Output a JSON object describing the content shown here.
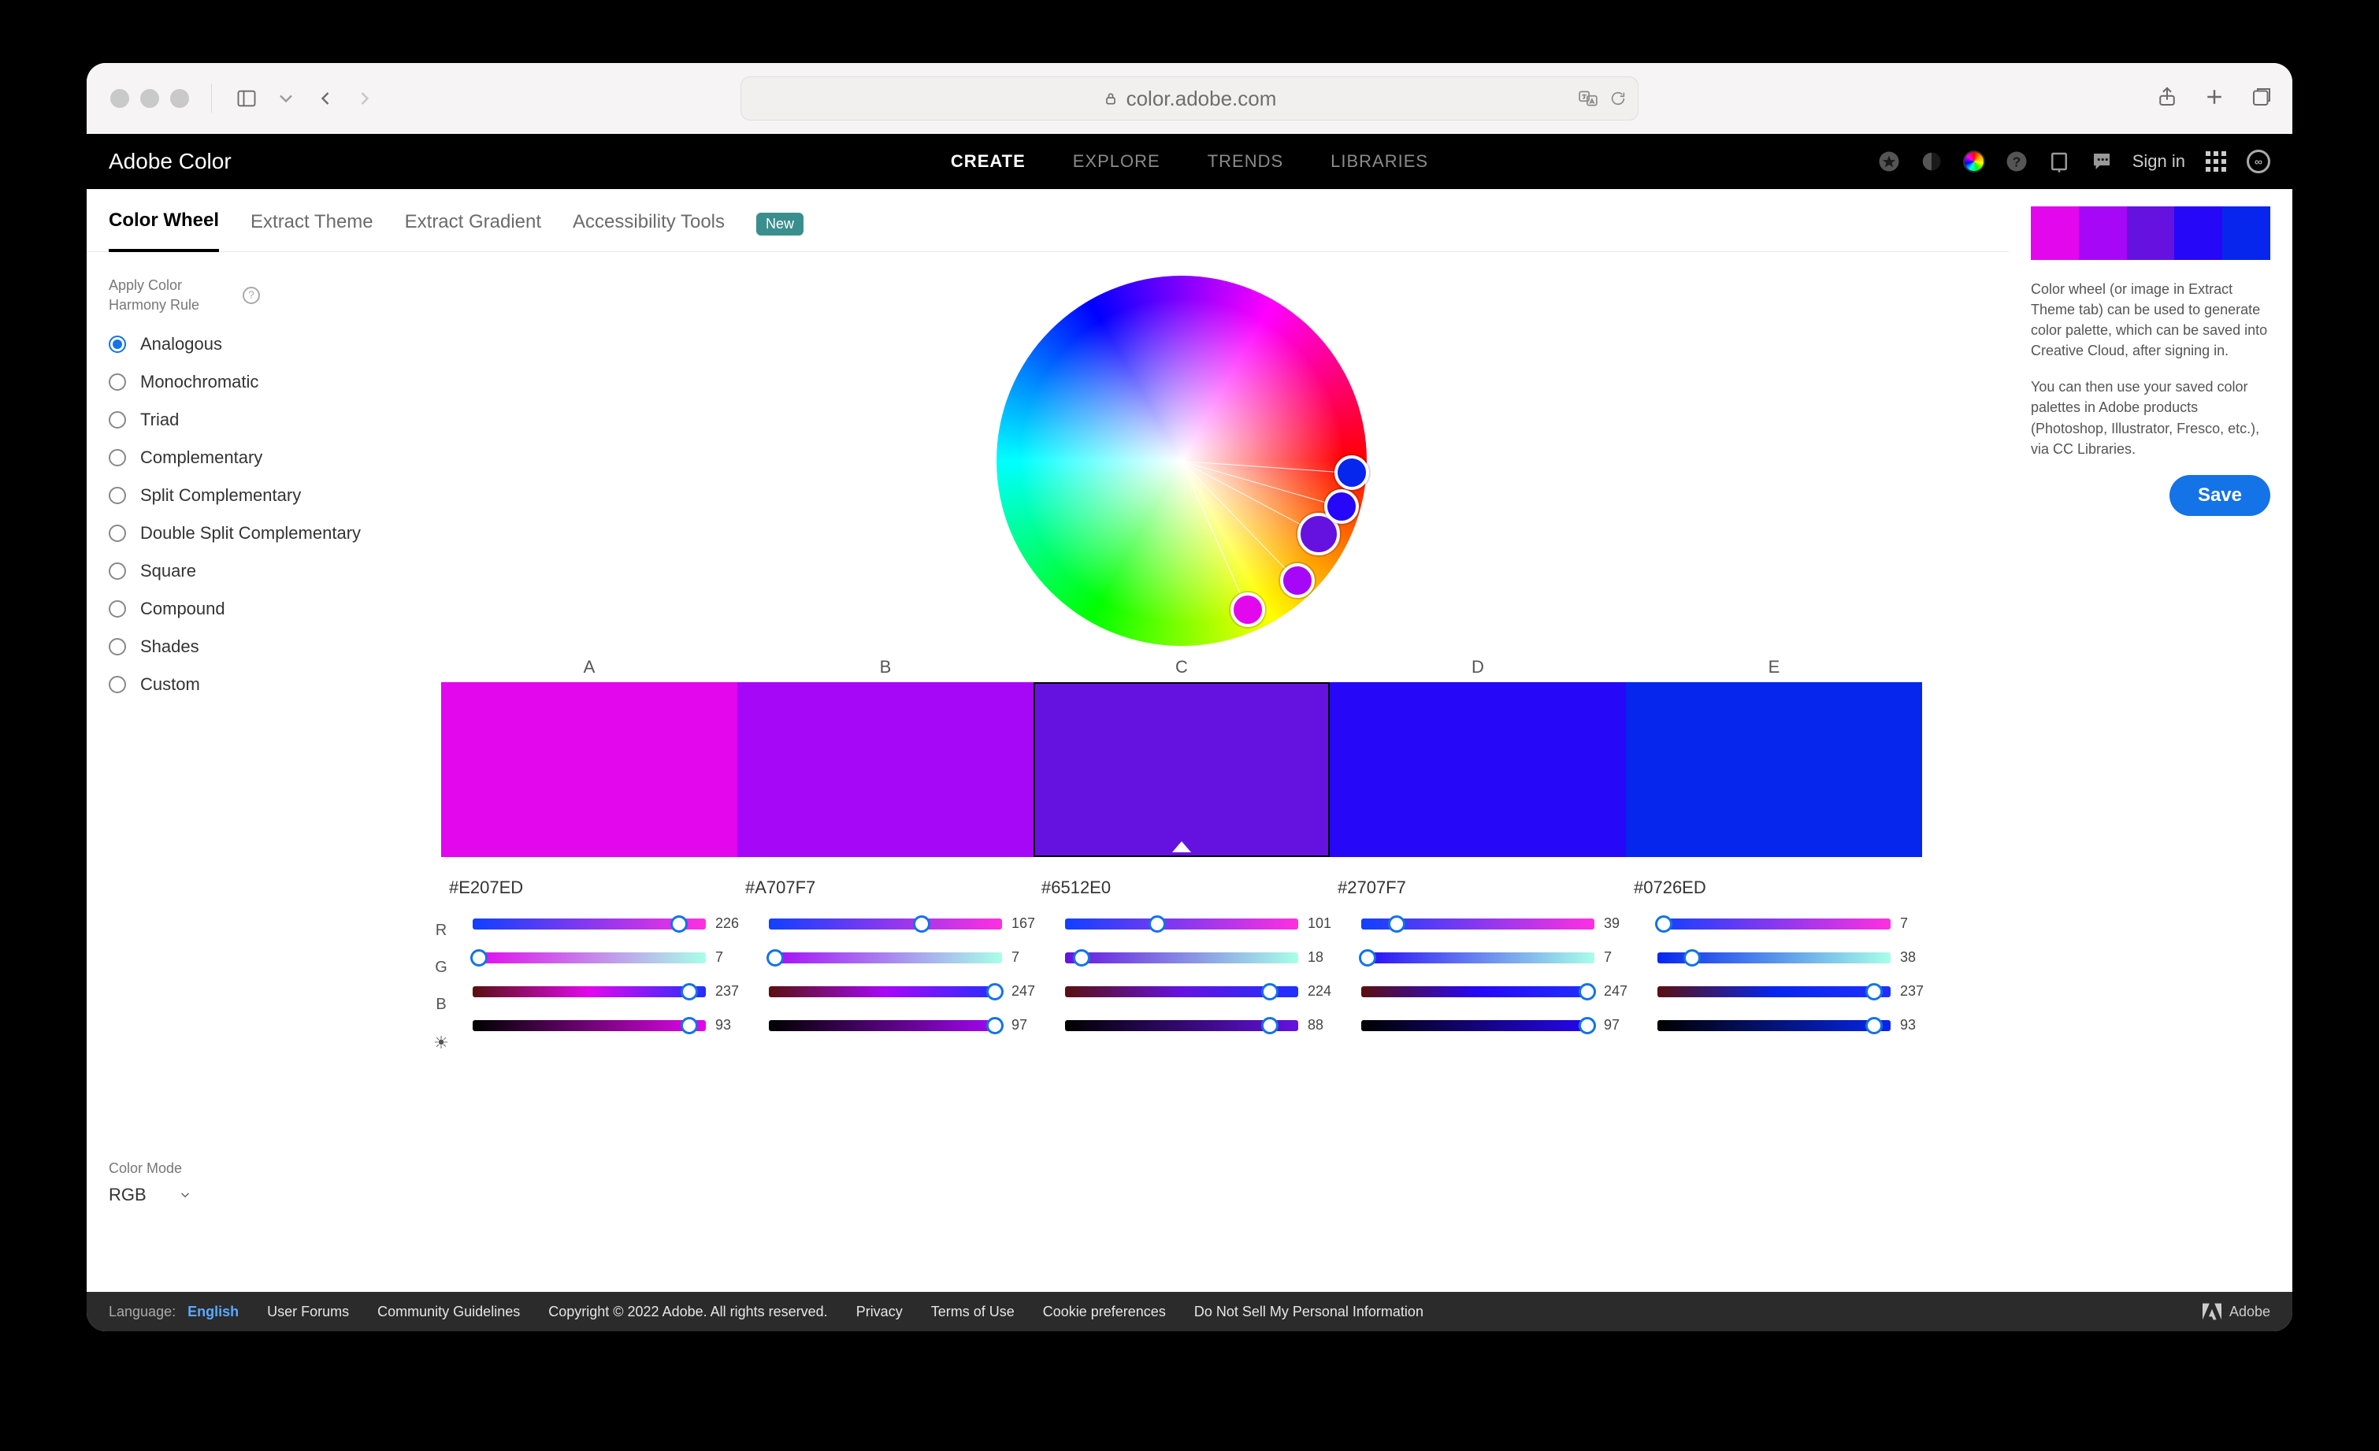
{
  "browser": {
    "url_display": "color.adobe.com",
    "lock_icon": "lock-icon"
  },
  "nav": {
    "logo": "Adobe Color",
    "items": [
      "CREATE",
      "EXPLORE",
      "TRENDS",
      "LIBRARIES"
    ],
    "active": "CREATE",
    "signin": "Sign in"
  },
  "subnav": {
    "tabs": [
      "Color Wheel",
      "Extract Theme",
      "Extract Gradient",
      "Accessibility Tools"
    ],
    "active": "Color Wheel",
    "new_badge": "New"
  },
  "sidebar": {
    "harmony_label": "Apply Color Harmony Rule",
    "harmony_options": [
      "Analogous",
      "Monochromatic",
      "Triad",
      "Complementary",
      "Split Complementary",
      "Double Split Complementary",
      "Square",
      "Compound",
      "Shades",
      "Custom"
    ],
    "harmony_selected": "Analogous"
  },
  "color_mode": {
    "label": "Color Mode",
    "value": "RGB"
  },
  "column_letters": [
    "A",
    "B",
    "C",
    "D",
    "E"
  ],
  "selected_swatch_index": 2,
  "swatches": [
    {
      "hex": "#E207ED",
      "r": 226,
      "g": 7,
      "b": 237,
      "brightness": 93
    },
    {
      "hex": "#A707F7",
      "r": 167,
      "g": 7,
      "b": 247,
      "brightness": 97
    },
    {
      "hex": "#6512E0",
      "r": 101,
      "g": 18,
      "b": 224,
      "brightness": 88
    },
    {
      "hex": "#2707F7",
      "r": 39,
      "g": 7,
      "b": 247,
      "brightness": 97
    },
    {
      "hex": "#0726ED",
      "r": 7,
      "g": 38,
      "b": 237,
      "brightness": 93
    }
  ],
  "channel_labels": {
    "r": "R",
    "g": "G",
    "b": "B"
  },
  "right_panel": {
    "p1": "Color wheel (or image in Extract Theme tab) can be used to generate color palette, which can be saved into Creative Cloud, after signing in.",
    "p2": "You can then use your saved color palettes in Adobe products (Photoshop, Illustrator, Fresco, etc.), via CC Libraries.",
    "save_label": "Save"
  },
  "footer": {
    "language_label": "Language:",
    "language_value": "English",
    "links": [
      "User Forums",
      "Community Guidelines",
      "Copyright © 2022 Adobe. All rights reserved.",
      "Privacy",
      "Terms of Use",
      "Cookie preferences",
      "Do Not Sell My Personal Information"
    ],
    "brand": "Adobe"
  },
  "wheel_nodes": [
    {
      "angle_deg": 24,
      "radius_pct": 88,
      "base": false
    },
    {
      "angle_deg": 44,
      "radius_pct": 90,
      "base": false
    },
    {
      "angle_deg": 62,
      "radius_pct": 84,
      "base": true
    },
    {
      "angle_deg": 74,
      "radius_pct": 90,
      "base": false
    },
    {
      "angle_deg": 86,
      "radius_pct": 92,
      "base": false
    }
  ]
}
